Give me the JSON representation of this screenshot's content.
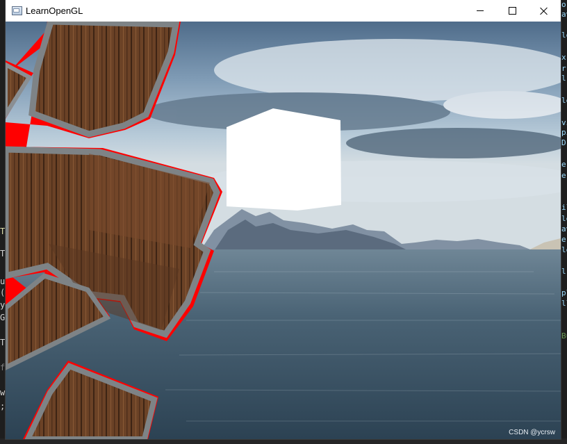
{
  "window": {
    "title": "LearnOpenGL",
    "controls": {
      "minimize": "minimize",
      "maximize": "maximize",
      "close": "close"
    }
  },
  "background_editor": {
    "right_fragments": [
      "o",
      "av",
      "le",
      "x",
      "r",
      "l",
      "le",
      "vi",
      "pi",
      "D:",
      "e",
      "e",
      "il",
      "le",
      "av",
      "e",
      "le",
      "l",
      "pl",
      "ll",
      "Bu"
    ],
    "left_fragments": [
      "T",
      "T",
      "u",
      "(",
      "y",
      "G",
      "T",
      "f",
      "w",
      ";"
    ]
  },
  "scene": {
    "objects": [
      "skybox-lake-mountains",
      "light-cube",
      "wooden-crates-outlined"
    ],
    "outline_color": "#ff0000",
    "light_color": "#ffffff"
  },
  "watermark": "CSDN @ycrsw"
}
